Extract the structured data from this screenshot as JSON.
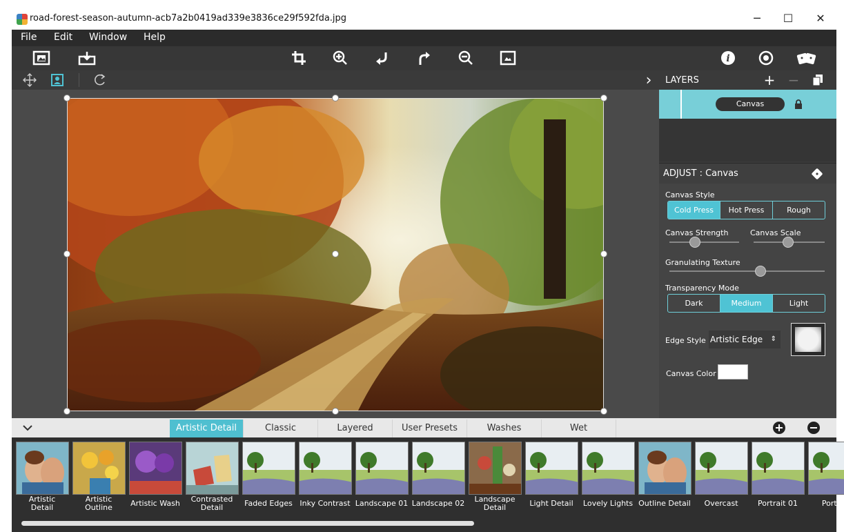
{
  "window": {
    "title": "road-forest-season-autumn-acb7a2b0419ad339e3836ce29f592fda.jpg",
    "minimize_glyph": "─",
    "maximize_glyph": "☐",
    "close_glyph": "✕"
  },
  "menu": {
    "items": [
      "File",
      "Edit",
      "Window",
      "Help"
    ]
  },
  "toolbar": {
    "left_icons": [
      "open-image-icon",
      "save-icon"
    ],
    "center_icons": [
      "crop-icon",
      "zoom-in-icon",
      "undo-icon",
      "redo-icon",
      "zoom-out-icon",
      "fit-icon"
    ],
    "right_icons": [
      "info-icon",
      "settings-icon",
      "presets-icon"
    ]
  },
  "subtoolbar": {
    "icons": [
      "move-icon",
      "select-icon",
      "rotate-icon"
    ],
    "collapse_glyph": "›"
  },
  "layers": {
    "title": "LAYERS",
    "add_glyph": "+",
    "remove_glyph": "−",
    "layer_name": "Canvas",
    "lock_glyph": "🔒"
  },
  "adjust": {
    "title": "ADJUST : Canvas",
    "canvas_style_label": "Canvas Style",
    "canvas_style_options": [
      "Cold Press",
      "Hot Press",
      "Rough"
    ],
    "canvas_style_selected": "Cold Press",
    "canvas_strength_label": "Canvas Strength",
    "canvas_strength_value": 0.3,
    "canvas_scale_label": "Canvas Scale",
    "canvas_scale_value": 0.5,
    "granulating_texture_label": "Granulating Texture",
    "granulating_texture_value": 0.6,
    "transparency_mode_label": "Transparency Mode",
    "transparency_mode_options": [
      "Dark",
      "Medium",
      "Light"
    ],
    "transparency_mode_selected": "Medium",
    "edge_style_label": "Edge Style",
    "edge_style_value": "Artistic Edge",
    "canvas_color_label": "Canvas Color",
    "canvas_color": "#ffffff"
  },
  "presets": {
    "expand_glyph": "⌄",
    "tabs": [
      "Artistic Detail",
      "Classic",
      "Layered",
      "User Presets",
      "Washes",
      "Wet"
    ],
    "active_tab": "Artistic Detail",
    "items": [
      {
        "label": "Artistic Detail",
        "kind": "portrait"
      },
      {
        "label": "Artistic Outline",
        "kind": "flowers"
      },
      {
        "label": "Artistic Wash",
        "kind": "purple"
      },
      {
        "label": "Contrasted Detail",
        "kind": "boats"
      },
      {
        "label": "Faded Edges",
        "kind": "landscape"
      },
      {
        "label": "Inky Contrast",
        "kind": "landscape"
      },
      {
        "label": "Landscape 01",
        "kind": "landscape"
      },
      {
        "label": "Landscape 02",
        "kind": "landscape"
      },
      {
        "label": "Landscape Detail",
        "kind": "garden"
      },
      {
        "label": "Light Detail",
        "kind": "landscape"
      },
      {
        "label": "Lovely Lights",
        "kind": "landscape"
      },
      {
        "label": "Outline Detail",
        "kind": "portrait"
      },
      {
        "label": "Overcast",
        "kind": "landscape"
      },
      {
        "label": "Portrait 01",
        "kind": "landscape"
      },
      {
        "label": "Portrai",
        "kind": "landscape"
      }
    ]
  },
  "colors": {
    "accent": "#4fc3d4",
    "layer_row": "#78cfd8",
    "panel_bg": "#444444",
    "menubar_bg": "#2b2b2b"
  }
}
